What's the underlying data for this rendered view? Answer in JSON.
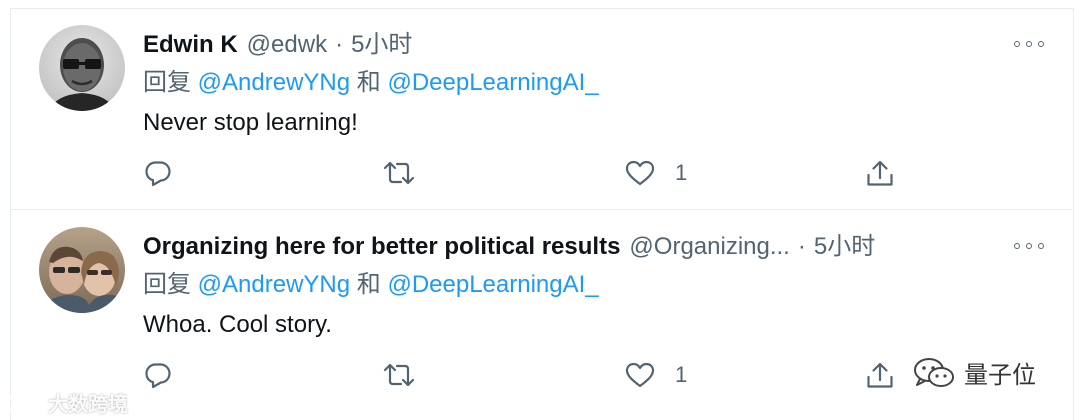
{
  "tweets": [
    {
      "author_name": "Edwin K",
      "handle": "@edwk",
      "separator": "·",
      "time": "5小时",
      "reply_prefix": "回复",
      "reply_mention_1": "@AndrewYNg",
      "reply_joiner": " 和 ",
      "reply_mention_2": "@DeepLearningAI_",
      "text": "Never stop learning!",
      "like_count": "1",
      "avatar_icon": "avatar-man-glasses"
    },
    {
      "author_name": "Organizing here for better political results",
      "handle": "@Organizing...",
      "separator": "·",
      "time": "5小时",
      "reply_prefix": "回复",
      "reply_mention_1": "@AndrewYNg",
      "reply_joiner": " 和 ",
      "reply_mention_2": "@DeepLearningAI_",
      "text": "Whoa. Cool story.",
      "like_count": "1",
      "avatar_icon": "avatar-couple-selfie"
    }
  ],
  "icons": {
    "reply": "reply-icon",
    "retweet": "retweet-icon",
    "like": "heart-icon",
    "share": "share-icon",
    "more": "more-options-icon"
  },
  "watermarks": {
    "left": "大数跨境",
    "right": "量子位"
  },
  "colors": {
    "link": "#1d9bf0",
    "secondary_text": "#536471",
    "primary_text": "#0f1419",
    "divider": "#e6ecf0"
  }
}
